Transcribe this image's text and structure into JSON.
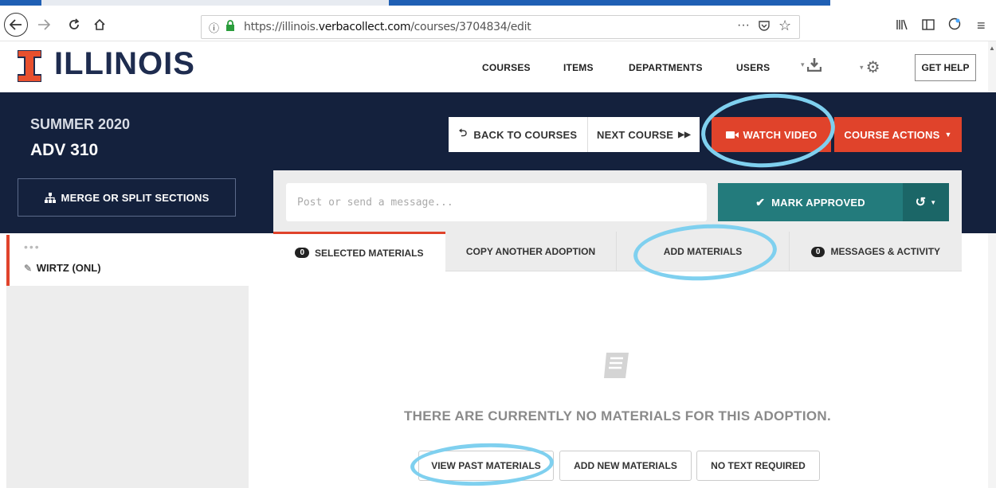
{
  "browser": {
    "url_prefix": "https://illinois.",
    "url_domain": "verbacollect.com",
    "url_path": "/courses/3704834/edit"
  },
  "header": {
    "logo": "ILLINOIS",
    "nav": [
      "COURSES",
      "ITEMS",
      "DEPARTMENTS",
      "USERS"
    ],
    "get_help": "GET HELP"
  },
  "course": {
    "term": "SUMMER 2020",
    "name": "ADV 310"
  },
  "actions": {
    "back": "BACK TO COURSES",
    "next": "NEXT COURSE",
    "watch": "WATCH VIDEO",
    "course_actions": "COURSE ACTIONS",
    "merge": "MERGE OR SPLIT SECTIONS",
    "mark_approved": "MARK APPROVED"
  },
  "message": {
    "placeholder": "Post or send a message..."
  },
  "tabs": [
    {
      "label": "SELECTED MATERIALS",
      "count": "0"
    },
    {
      "label": "COPY ANOTHER ADOPTION"
    },
    {
      "label": "ADD MATERIALS"
    },
    {
      "label": "MESSAGES & ACTIVITY",
      "count": "0"
    }
  ],
  "sidebar": {
    "dots": "•••",
    "section": "WIRTZ (ONL)"
  },
  "empty": {
    "message": "THERE ARE CURRENTLY NO MATERIALS FOR THIS ADOPTION.",
    "buttons": [
      "VIEW PAST MATERIALS",
      "ADD NEW MATERIALS",
      "NO TEXT REQUIRED"
    ]
  },
  "colors": {
    "navy": "#14213d",
    "orange": "#e0432b",
    "teal": "#237b7c",
    "highlight": "#7fd0ef"
  }
}
